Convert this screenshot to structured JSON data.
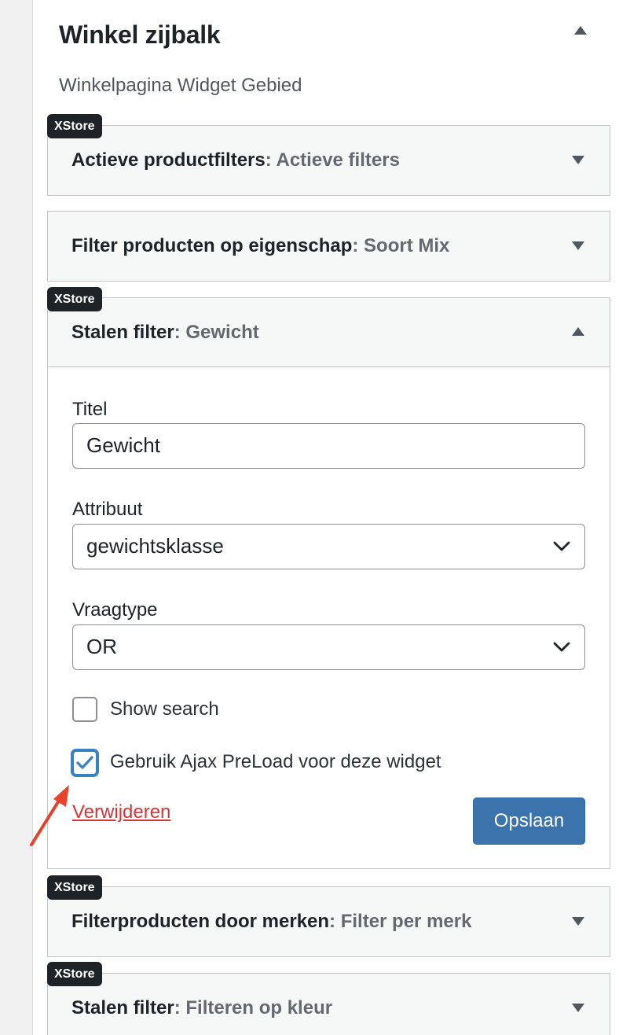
{
  "sidebar_area": {
    "title": "Winkel zijbalk",
    "description": "Winkelpagina Widget Gebied",
    "toggle_icon": "triangle-up-icon"
  },
  "badge_label": "XStore",
  "widgets": [
    {
      "name": "Actieve productfilters",
      "subtitle": ": Actieve filters",
      "badge": true,
      "expanded": false
    },
    {
      "name": "Filter producten op eigenschap",
      "subtitle": ": Soort Mix",
      "badge": false,
      "expanded": false
    },
    {
      "name": "Stalen filter",
      "subtitle": ": Gewicht",
      "badge": true,
      "expanded": true
    },
    {
      "name": "Filterproducten door merken",
      "subtitle": ": Filter per merk",
      "badge": true,
      "expanded": false
    },
    {
      "name": "Stalen filter",
      "subtitle": ": Filteren op kleur",
      "badge": true,
      "expanded": false
    }
  ],
  "open_widget_form": {
    "title_label": "Titel",
    "title_value": "Gewicht",
    "attribute_label": "Attribuut",
    "attribute_value": "gewichtsklasse",
    "query_type_label": "Vraagtype",
    "query_type_value": "OR",
    "show_search_label": "Show search",
    "show_search_checked": false,
    "ajax_preload_label": "Gebruik Ajax PreLoad voor deze widget",
    "ajax_preload_checked": true,
    "delete_label": "Verwijderen",
    "save_label": "Opslaan"
  },
  "colors": {
    "accent": "#3b73ad",
    "checkbox_focus": "#3582c4",
    "delete": "#d63638",
    "annotation_arrow": "#e8412c",
    "badge_bg": "#1d2327"
  }
}
